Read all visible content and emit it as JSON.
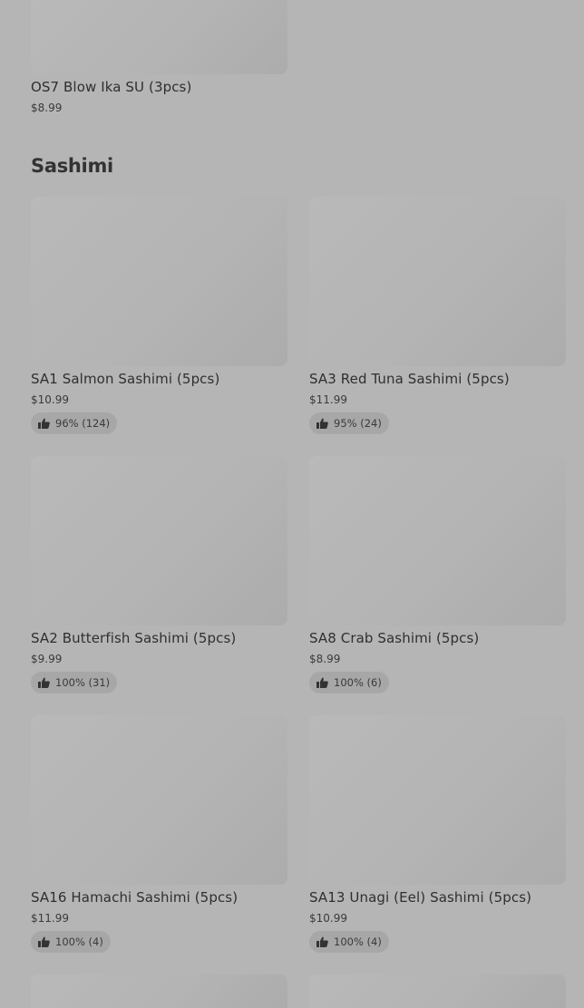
{
  "prev_item": {
    "name": "OS7 Blow Ika SU (3pcs)",
    "price": "$8.99"
  },
  "section": {
    "title": "Sashimi"
  },
  "items": [
    {
      "name": "SA1 Salmon Sashimi (5pcs)",
      "price": "$10.99",
      "rating": "96% (124)",
      "icon": "thumbs-up-icon"
    },
    {
      "name": "SA3 Red Tuna Sashimi (5pcs)",
      "price": "$11.99",
      "rating": "95% (24)",
      "icon": "thumbs-up-icon"
    },
    {
      "name": "SA2 Butterfish Sashimi (5pcs)",
      "price": "$9.99",
      "rating": "100% (31)",
      "icon": "thumbs-up-icon"
    },
    {
      "name": "SA8 Crab Sashimi (5pcs)",
      "price": "$8.99",
      "rating": "100% (6)",
      "icon": "thumbs-up-icon"
    },
    {
      "name": "SA16 Hamachi Sashimi (5pcs)",
      "price": "$11.99",
      "rating": "100% (4)",
      "icon": "thumbs-up-icon"
    },
    {
      "name": "SA13 Unagi (Eel) Sashimi (5pcs)",
      "price": "$10.99",
      "rating": "100% (4)",
      "icon": "thumbs-up-icon"
    }
  ],
  "colors": {
    "overlay_bg": "#b5b5b5",
    "badge_bg": "#a7a7a7",
    "text": "#2f2f2f"
  }
}
